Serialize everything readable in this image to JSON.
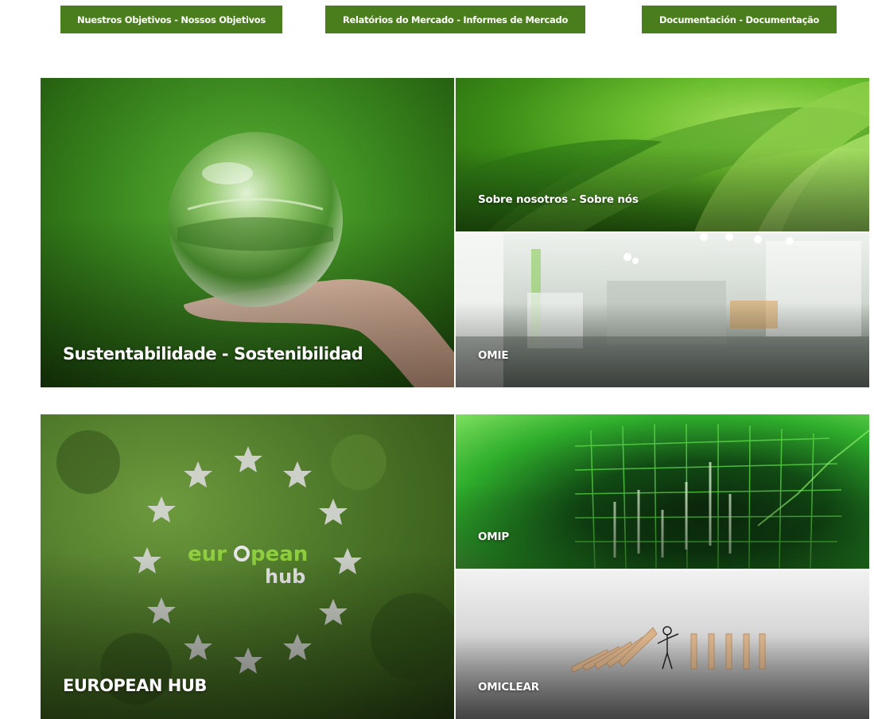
{
  "nav": {
    "buttons": [
      {
        "label": "Nuestros Objetivos - Nossos Objetivos"
      },
      {
        "label": "Relatórios do Mercado - Informes de Mercado"
      },
      {
        "label": "Documentación - Documentação"
      }
    ]
  },
  "tiles": {
    "sustentabilidade": {
      "label": "Sustentabilidade - Sostenibilidad"
    },
    "sobre": {
      "label": "Sobre nosotros - Sobre nós"
    },
    "omie": {
      "label": "OMIE"
    },
    "european_hub": {
      "label": "EUROPEAN HUB",
      "logo_word_1": "eur",
      "logo_word_2": "pean",
      "logo_word_3": "hub"
    },
    "omip": {
      "label": "OMIP"
    },
    "omiclear": {
      "label": "OMICLEAR"
    }
  },
  "colors": {
    "button_bg": "#4a7e1c",
    "button_text": "#ffffff",
    "label_text": "#ffffff"
  }
}
